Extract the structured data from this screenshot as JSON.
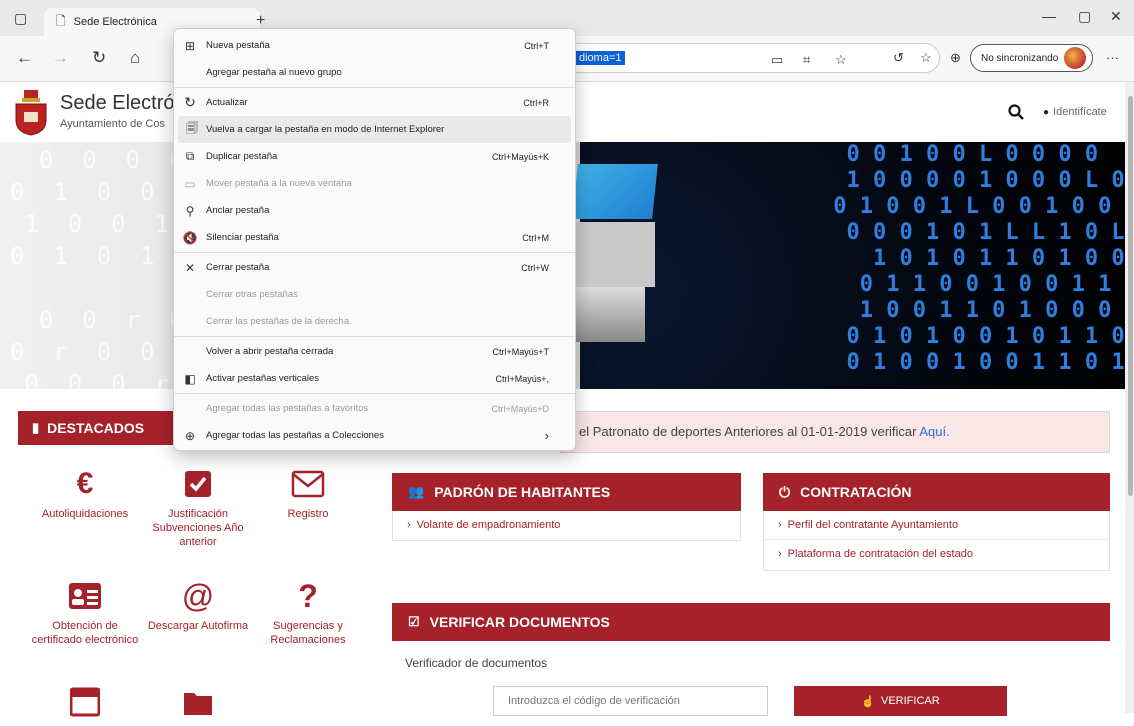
{
  "browser": {
    "tab_title": "Sede Electrónica",
    "url_visible": "dioma=1",
    "sync_label": "No sincronizando"
  },
  "context_menu": {
    "items": [
      {
        "label": "Nueva pestaña",
        "shortcut": "Ctrl+T",
        "icon": "new-tab-icon",
        "disabled": false
      },
      {
        "label": "Agregar pestaña al nuevo grupo",
        "shortcut": "",
        "icon": "",
        "disabled": false
      },
      {
        "separator": true
      },
      {
        "label": "Actualizar",
        "shortcut": "Ctrl+R",
        "icon": "refresh-icon",
        "disabled": false
      },
      {
        "label": "Vuelva a cargar la pestaña en modo de Internet Explorer",
        "shortcut": "",
        "icon": "ie-mode-icon",
        "disabled": false,
        "highlighted": true
      },
      {
        "label": "Duplicar pestaña",
        "shortcut": "Ctrl+Mayús+K",
        "icon": "duplicate-icon",
        "disabled": false
      },
      {
        "label": "Mover pestaña a la nueva ventana",
        "shortcut": "",
        "icon": "move-window-icon",
        "disabled": true
      },
      {
        "label": "Anclar pestaña",
        "shortcut": "",
        "icon": "pin-icon",
        "disabled": false
      },
      {
        "label": "Silenciar pestaña",
        "shortcut": "Ctrl+M",
        "icon": "mute-icon",
        "disabled": false
      },
      {
        "separator": true
      },
      {
        "label": "Cerrar pestaña",
        "shortcut": "Ctrl+W",
        "icon": "close-icon",
        "disabled": false
      },
      {
        "label": "Cerrar otras pestañas",
        "shortcut": "",
        "icon": "",
        "disabled": true
      },
      {
        "label": "Cerrar las pestañas de la derecha",
        "shortcut": "",
        "icon": "",
        "disabled": true
      },
      {
        "separator": true
      },
      {
        "label": "Volver a abrir pestaña cerrada",
        "shortcut": "Ctrl+Mayús+T",
        "icon": "",
        "disabled": false
      },
      {
        "label": "Activar pestañas verticales",
        "shortcut": "Ctrl+Mayús+,",
        "icon": "vertical-tabs-icon",
        "disabled": false
      },
      {
        "separator": true
      },
      {
        "label": "Agregar todas las pestañas a favoritos",
        "shortcut": "Ctrl+Mayús+D",
        "icon": "",
        "disabled": true
      },
      {
        "label": "Agregar todas las pestañas a Colecciones",
        "shortcut": "",
        "icon": "collections-icon",
        "disabled": false,
        "submenu": true
      }
    ]
  },
  "site": {
    "title": "Sede Electrónic",
    "subtitle": "Ayuntamiento de Cos",
    "identify": "Identifícate"
  },
  "notice": {
    "text": "el Patronato de deportes Anteriores al 01-01-2019 verificar ",
    "link": "Aquí."
  },
  "destacados": {
    "heading": "DESTACADOS",
    "items": [
      {
        "label": "Autoliquidaciones",
        "icon": "euro-icon"
      },
      {
        "label": "Justificación Subvenciones Año anterior",
        "icon": "checkbox-icon"
      },
      {
        "label": "Registro",
        "icon": "envelope-icon"
      },
      {
        "label": "Obtención de certificado electrónico",
        "icon": "id-card-icon"
      },
      {
        "label": "Descargar Autofirma",
        "icon": "at-icon"
      },
      {
        "label": "Sugerencias y Reclamaciones",
        "icon": "question-icon"
      }
    ]
  },
  "panels": {
    "padron": {
      "heading": "PADRÓN DE HABITANTES",
      "links": [
        "Volante de empadronamiento"
      ]
    },
    "contratacion": {
      "heading": "CONTRATACIÓN",
      "links": [
        "Perfil del contratante Ayuntamiento",
        "Plataforma de contratación del estado"
      ]
    },
    "verificar": {
      "heading": "VERIFICAR DOCUMENTOS",
      "label": "Verificador de documentos",
      "placeholder": "Introduzca el código de verificación",
      "button": "VERIFICAR"
    }
  },
  "colors": {
    "accent": "#a6222a",
    "link": "#2a6fd6"
  }
}
